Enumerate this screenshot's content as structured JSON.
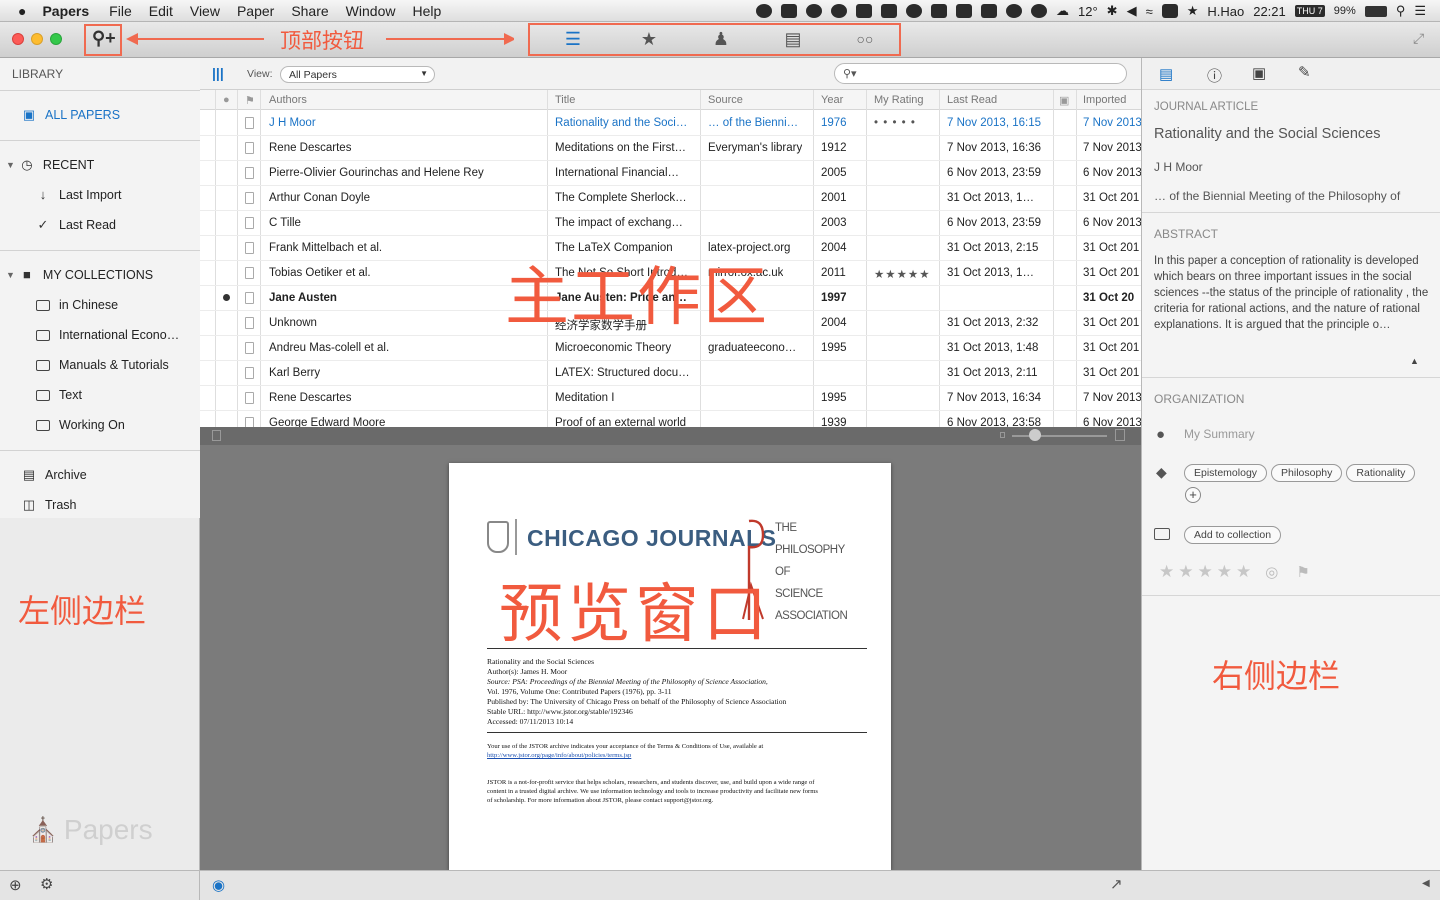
{
  "menubar": {
    "apple_symbol": "",
    "app_name": "Papers",
    "items": [
      "File",
      "Edit",
      "View",
      "Paper",
      "Share",
      "Window",
      "Help"
    ],
    "battery": "99%",
    "weather": "12°",
    "user": "H.Hao",
    "time": "22:21",
    "day": "THU 7"
  },
  "toolbar": {
    "annotation": "顶部按钮",
    "mode_icons": [
      "list-icon",
      "star-icon",
      "person-icon",
      "book-icon",
      "glasses-icon"
    ]
  },
  "sidebar": {
    "header": "LIBRARY",
    "all_papers": "ALL PAPERS",
    "recent": "RECENT",
    "last_import": "Last Import",
    "last_read": "Last Read",
    "collections": "MY COLLECTIONS",
    "collection_items": [
      "in Chinese",
      "International Econo…",
      "Manuals & Tutorials",
      "Text",
      "Working On"
    ],
    "archive": "Archive",
    "trash": "Trash",
    "watermark": "Papers",
    "annotation": "左侧边栏"
  },
  "filter": {
    "view_label": "View:",
    "view_value": "All Papers"
  },
  "table": {
    "headers": [
      "Authors",
      "Title",
      "Source",
      "Year",
      "My Rating",
      "Last Read",
      "Imported"
    ],
    "rows": [
      {
        "authors": "J H Moor",
        "title": "Rationality and the Soci…",
        "source": "… of the Bienni…",
        "year": "1976",
        "rating": "• • • • •",
        "last_read": "7 Nov 2013, 16:15",
        "imported": "7 Nov 2013"
      },
      {
        "authors": "Rene Descartes",
        "title": "Meditations on the First…",
        "source": "Everyman's library",
        "year": "1912",
        "rating": "",
        "last_read": "7 Nov 2013, 16:36",
        "imported": "7 Nov 2013"
      },
      {
        "authors": "Pierre-Olivier Gourinchas and Helene Rey",
        "title": "International Financial…",
        "source": "",
        "year": "2005",
        "rating": "",
        "last_read": "6 Nov 2013, 23:59",
        "imported": "6 Nov 2013"
      },
      {
        "authors": "Arthur Conan Doyle",
        "title": "The Complete Sherlock…",
        "source": "",
        "year": "2001",
        "rating": "",
        "last_read": "31 Oct 2013, 1…",
        "imported": "31 Oct 201"
      },
      {
        "authors": "C Tille",
        "title": "The impact of exchang…",
        "source": "",
        "year": "2003",
        "rating": "",
        "last_read": "6 Nov 2013, 23:59",
        "imported": "6 Nov 2013"
      },
      {
        "authors": "Frank Mittelbach et al.",
        "title": "The LaTeX Companion",
        "source": "latex-project.org",
        "year": "2004",
        "rating": "",
        "last_read": "31 Oct 2013, 2:15",
        "imported": "31 Oct 201"
      },
      {
        "authors": "Tobias Oetiker et al.",
        "title": "The Not So Short Introd…",
        "source": "mirror.ox.ac.uk",
        "year": "2011",
        "rating": "★★★★★",
        "last_read": "31 Oct 2013, 1…",
        "imported": "31 Oct 201"
      },
      {
        "authors": "Jane Austen",
        "title": "Jane Austen: Pride an…",
        "source": "",
        "year": "1997",
        "rating": "",
        "last_read": "",
        "imported": "31 Oct 20"
      },
      {
        "authors": "Unknown",
        "title": "经济学家数学手册",
        "source": "",
        "year": "2004",
        "rating": "",
        "last_read": "31 Oct 2013, 2:32",
        "imported": "31 Oct 201"
      },
      {
        "authors": "Andreu Mas-colell et al.",
        "title": "Microeconomic Theory",
        "source": "graduateecono…",
        "year": "1995",
        "rating": "",
        "last_read": "31 Oct 2013, 1:48",
        "imported": "31 Oct 201"
      },
      {
        "authors": "Karl Berry",
        "title": "LATEX: Structured docu…",
        "source": "",
        "year": "",
        "rating": "",
        "last_read": "31 Oct 2013, 2:11",
        "imported": "31 Oct 201"
      },
      {
        "authors": "Rene Descartes",
        "title": "Meditation I",
        "source": "",
        "year": "1995",
        "rating": "",
        "last_read": "7 Nov 2013, 16:34",
        "imported": "7 Nov 2013"
      },
      {
        "authors": "George Edward Moore",
        "title": "Proof of an external world",
        "source": "",
        "year": "1939",
        "rating": "",
        "last_read": "6 Nov 2013, 23:58",
        "imported": "6 Nov 2013"
      }
    ],
    "annotation": "主工作区"
  },
  "preview": {
    "journal": "CHICAGO JOURNALS",
    "psa_lines": [
      "THE",
      "PHILOSOPHY",
      "OF",
      "SCIENCE",
      "ASSOCIATION"
    ],
    "meta_lines": [
      "Rationality and the Social Sciences",
      "Author(s): James H. Moor",
      "Source: PSA: Proceedings of the Biennial Meeting of the Philosophy of Science Association,",
      "Vol. 1976, Volume One: Contributed Papers (1976), pp. 3-11",
      "Published by: The University of Chicago Press on behalf of the Philosophy of Science Association",
      "Stable URL: http://www.jstor.org/stable/192346",
      "Accessed: 07/11/2013 10:14"
    ],
    "terms_lines": [
      "Your use of the JSTOR archive indicates your acceptance of the Terms & Conditions of Use, available at",
      "http://www.jstor.org/page/info/about/policies/terms.jsp"
    ],
    "jstor_lines": [
      "JSTOR is a not-for-profit service that helps scholars, researchers, and students discover, use, and build upon a wide range of",
      "content in a trusted digital archive. We use information technology and tools to increase productivity and facilitate new forms",
      "of scholarship. For more information about JSTOR, please contact support@jstor.org."
    ],
    "annotation": "预览窗口"
  },
  "info": {
    "type": "JOURNAL ARTICLE",
    "title": "Rationality and the Social Sciences",
    "author": "J H Moor",
    "source": "… of the Biennial Meeting of the Philosophy of",
    "abstract_label": "ABSTRACT",
    "abstract": "In this paper a conception of rationality is developed which bears on three important issues in the social sciences --the status of the principle of rationality , the criteria for rational actions, and the nature of rational explanations. It is argued that the principle o…",
    "organization_label": "ORGANIZATION",
    "summary_placeholder": "My Summary",
    "tags": [
      "Epistemology",
      "Philosophy",
      "Rationality"
    ],
    "add_collection": "Add to collection",
    "annotation": "右侧边栏"
  }
}
